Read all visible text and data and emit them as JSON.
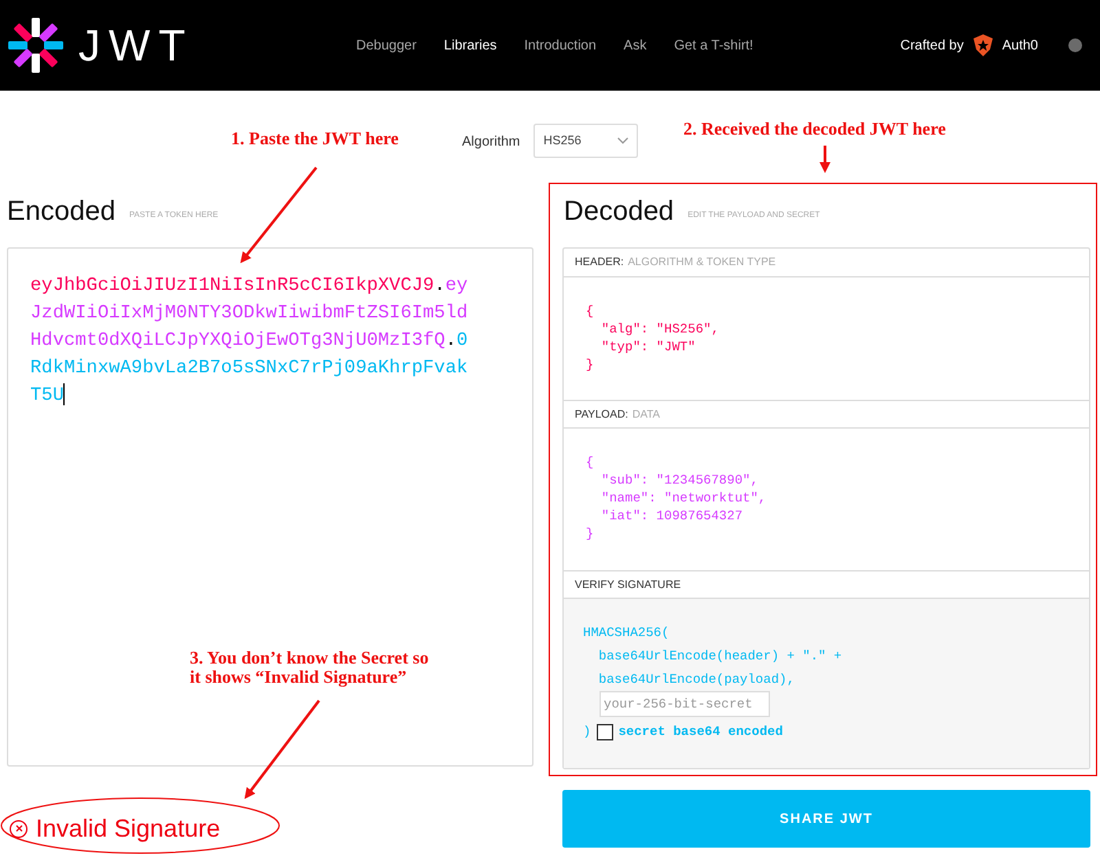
{
  "navbar": {
    "logo_text": "JWT",
    "links": [
      {
        "label": "Debugger",
        "selected": false
      },
      {
        "label": "Libraries",
        "selected": true
      },
      {
        "label": "Introduction",
        "selected": false
      },
      {
        "label": "Ask",
        "selected": false
      },
      {
        "label": "Get a T-shirt!",
        "selected": false
      }
    ],
    "crafted_by": "Crafted by",
    "brand": "Auth0"
  },
  "algorithm": {
    "label": "Algorithm",
    "value": "HS256"
  },
  "encoded": {
    "title": "Encoded",
    "hint": "PASTE A TOKEN HERE",
    "token": [
      {
        "kind": "header",
        "text": "eyJhbGciOiJIUzI1NiIsInR5cCI6IkpXVCJ9"
      },
      {
        "kind": "dot",
        "text": "."
      },
      {
        "kind": "payload",
        "text": "eyJzdWIiOiIxMjM0NTY3ODkwIiwibmFtZSI6Im5ldHdvcmt0dXQiLCJpYXQiOjEwOTg3NjU0MzI3fQ"
      },
      {
        "kind": "dot",
        "text": "."
      },
      {
        "kind": "signature",
        "text": "0RdkMinxwA9bvLa2B7o5sSNxC7rPj09aKhrpFvakT5U"
      }
    ]
  },
  "decoded": {
    "title": "Decoded",
    "hint": "EDIT THE PAYLOAD AND SECRET",
    "sections": [
      {
        "kind": "header",
        "label": "HEADER:",
        "sublabel": "ALGORITHM & TOKEN TYPE",
        "lines": [
          "{",
          "  \"alg\": \"HS256\",",
          "  \"typ\": \"JWT\"",
          "}"
        ]
      },
      {
        "kind": "payload",
        "label": "PAYLOAD:",
        "sublabel": "DATA",
        "lines": [
          "{",
          "  \"sub\": \"1234567890\",",
          "  \"name\": \"networktut\",",
          "  \"iat\": 10987654327",
          "}"
        ]
      },
      {
        "kind": "verify",
        "label": "VERIFY SIGNATURE",
        "lines": [
          "HMACSHA256(",
          "  base64UrlEncode(header) + \".\" +",
          "  base64UrlEncode(payload),"
        ],
        "secret_placeholder": "your-256-bit-secret",
        "closing": ")",
        "checkbox": {
          "label": "secret base64 encoded",
          "checked": false
        }
      }
    ]
  },
  "status": {
    "text": "Invalid Signature",
    "valid": false
  },
  "share_button": "SHARE JWT",
  "annotations": [
    {
      "text": "1. Paste the JWT here"
    },
    {
      "text": "2. Received the decoded JWT here"
    },
    {
      "text": "3. You don’t know the Secret so\nit shows “Invalid Signature”"
    }
  ]
}
